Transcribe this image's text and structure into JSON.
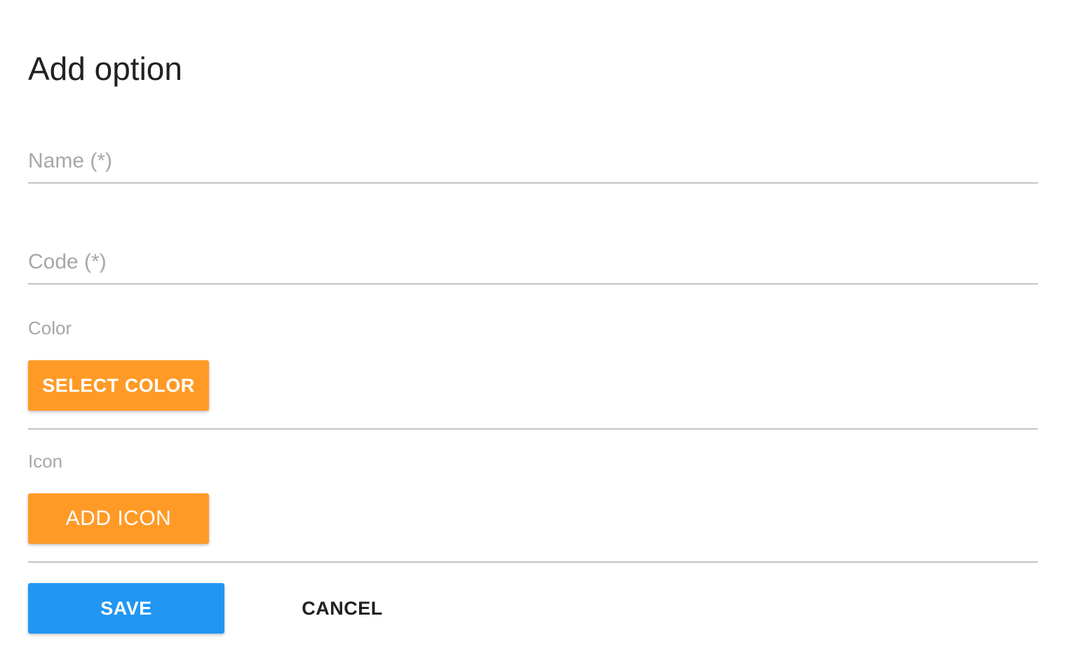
{
  "dialog": {
    "title": "Add option"
  },
  "form": {
    "name_placeholder": "Name (*)",
    "name_value": "",
    "code_placeholder": "Code (*)",
    "code_value": "",
    "color_label": "Color",
    "select_color_label": "SELECT COLOR",
    "icon_label": "Icon",
    "add_icon_label": "ADD ICON"
  },
  "actions": {
    "save_label": "SAVE",
    "cancel_label": "CANCEL"
  },
  "colors": {
    "accent_orange": "#ff9a26",
    "primary_blue": "#2196f3",
    "placeholder_gray": "#a7a7a7",
    "divider_gray": "#c4c4c4"
  }
}
